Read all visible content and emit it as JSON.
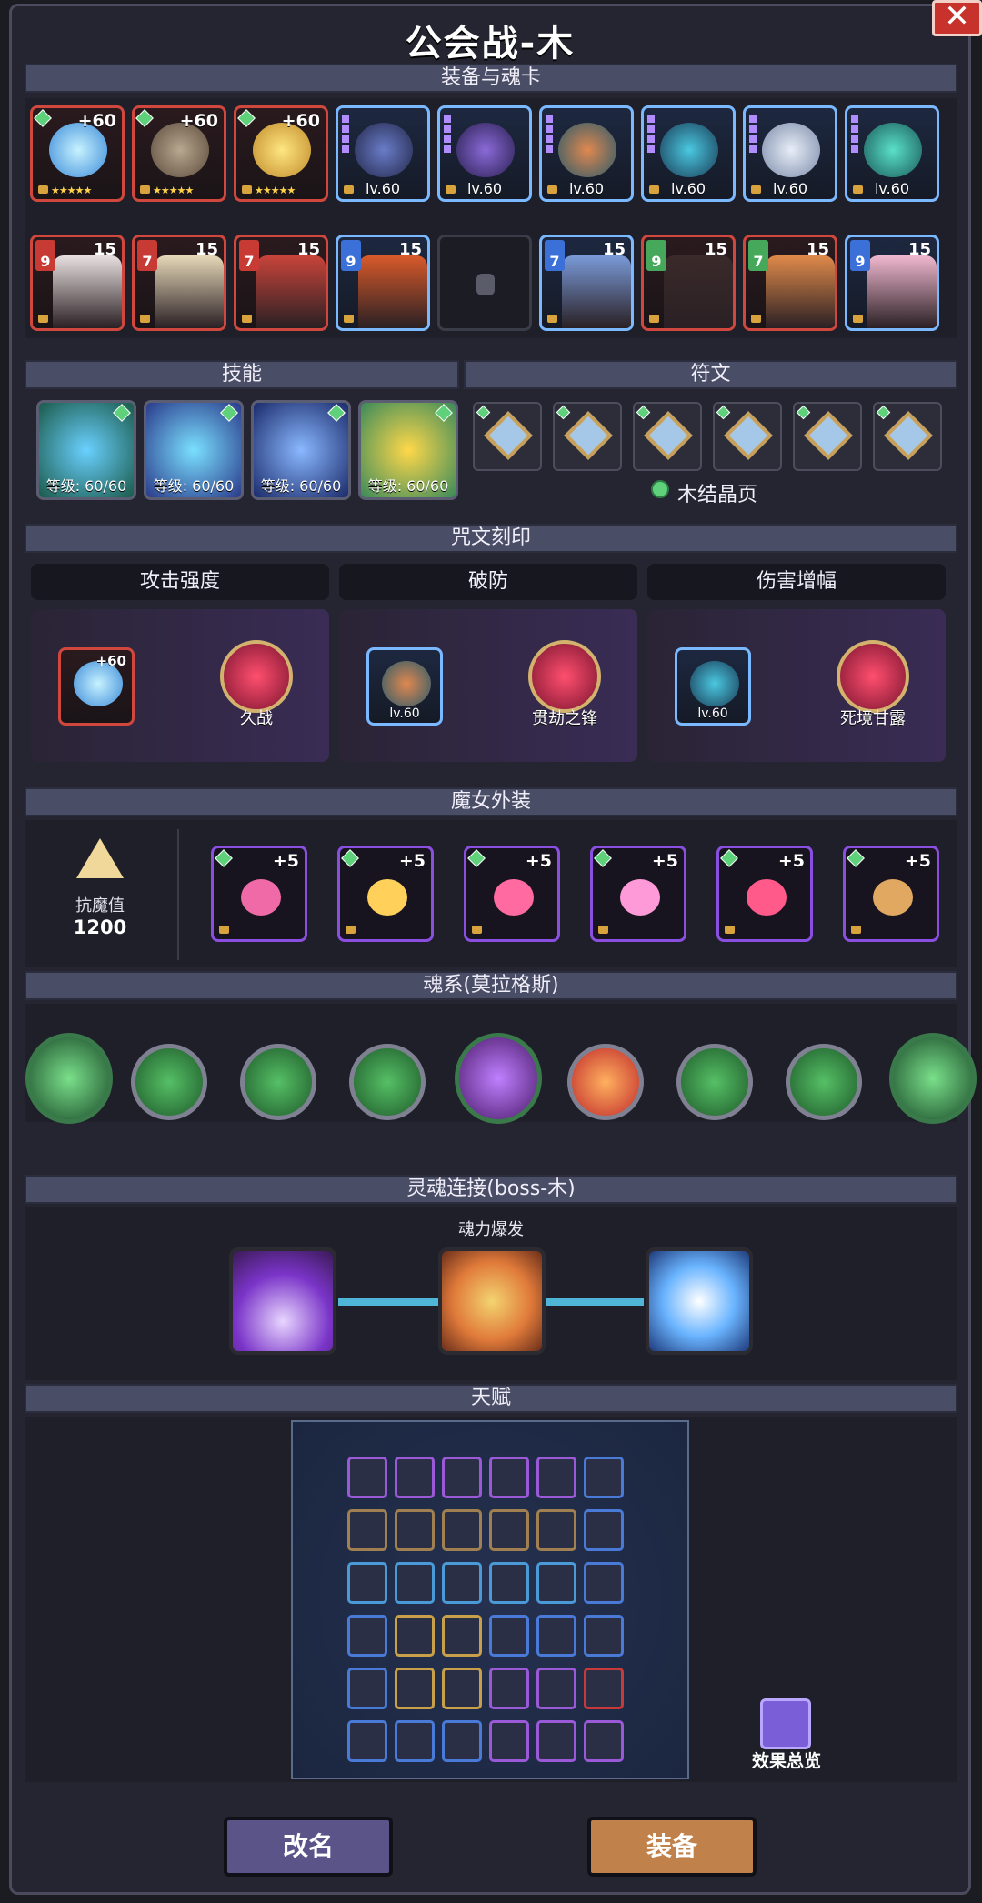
{
  "header": {
    "title": "公会战-木",
    "close_label": "✕"
  },
  "sections": {
    "equipment": "装备与魂卡",
    "skills": "技能",
    "runes": "符文",
    "inscription": "咒文刻印",
    "witch_outfit": "魔女外装",
    "soul_system": "魂系(莫拉格斯)",
    "soul_link": "灵魂连接(boss-木)",
    "talent": "天赋"
  },
  "equipment_row1": [
    {
      "plus": "+60",
      "type": "star"
    },
    {
      "plus": "+60",
      "type": "star"
    },
    {
      "plus": "+60",
      "type": "star"
    },
    {
      "level": "lv.60"
    },
    {
      "level": "lv.60"
    },
    {
      "level": "lv.60"
    },
    {
      "level": "lv.60"
    },
    {
      "level": "lv.60"
    },
    {
      "level": "lv.60"
    }
  ],
  "soul_cards": [
    {
      "badge": "9",
      "count": "15",
      "color": "red"
    },
    {
      "badge": "7",
      "count": "15",
      "color": "red"
    },
    {
      "badge": "7",
      "count": "15",
      "color": "red"
    },
    {
      "badge": "9",
      "count": "15",
      "color": "blue"
    },
    {
      "badge": "",
      "count": "",
      "color": "empty"
    },
    {
      "badge": "7",
      "count": "15",
      "color": "blue"
    },
    {
      "badge": "9",
      "count": "15",
      "color": "green"
    },
    {
      "badge": "7",
      "count": "15",
      "color": "green"
    },
    {
      "badge": "9",
      "count": "15",
      "color": "blue"
    }
  ],
  "skills": [
    {
      "level": "等级: 60/60"
    },
    {
      "level": "等级: 60/60"
    },
    {
      "level": "等级: 60/60"
    },
    {
      "level": "等级: 60/60"
    }
  ],
  "rune_set": "木结晶页",
  "inscriptions": [
    {
      "title": "攻击强度",
      "item": "+60",
      "crystal": "久战"
    },
    {
      "title": "破防",
      "item": "lv.60",
      "crystal": "贯劫之锋"
    },
    {
      "title": "伤害增幅",
      "item": "lv.60",
      "crystal": "死境甘露"
    }
  ],
  "outfit": {
    "stat_label": "抗魔值",
    "stat_value": "1200",
    "items": [
      "+5",
      "+5",
      "+5",
      "+5",
      "+5",
      "+5"
    ]
  },
  "soul_link": {
    "center_label": "魂力爆发"
  },
  "talent_overview": "效果总览",
  "buttons": {
    "rename": "改名",
    "equip": "装备"
  },
  "colors": {
    "red": "#d0473d",
    "blue": "#7ab8ff",
    "purple": "#9c62ff",
    "green": "#46a85a",
    "gold": "#ffd34a"
  }
}
